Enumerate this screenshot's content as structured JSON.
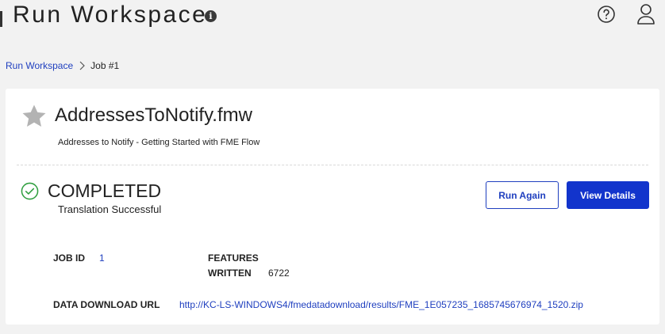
{
  "header": {
    "title": "Run Workspace",
    "info_icon": "info-icon",
    "help_icon": "question-circle-icon",
    "user_icon": "user-icon"
  },
  "breadcrumb": {
    "items": [
      "Run Workspace",
      "Job #1"
    ]
  },
  "job": {
    "workspace_name": "AddressesToNotify.fmw",
    "workspace_description": "Addresses to Notify - Getting Started with FME Flow",
    "status": "COMPLETED",
    "status_message": "Translation Successful",
    "status_color": "#2e9e3e",
    "job_id_label": "JOB ID",
    "job_id": "1",
    "features_label_line1": "FEATURES",
    "features_label_line2": "WRITTEN",
    "features_written": "6722",
    "download_url_label": "DATA DOWNLOAD URL",
    "download_url": "http://KC-LS-WINDOWS4/fmedatadownload/results/FME_1E057235_1685745676974_1520.zip"
  },
  "actions": {
    "run_again_label": "Run Again",
    "view_details_label": "View Details"
  },
  "colors": {
    "accent": "#1234cc",
    "link": "#1f3fbf",
    "background": "#f2f2f2"
  }
}
